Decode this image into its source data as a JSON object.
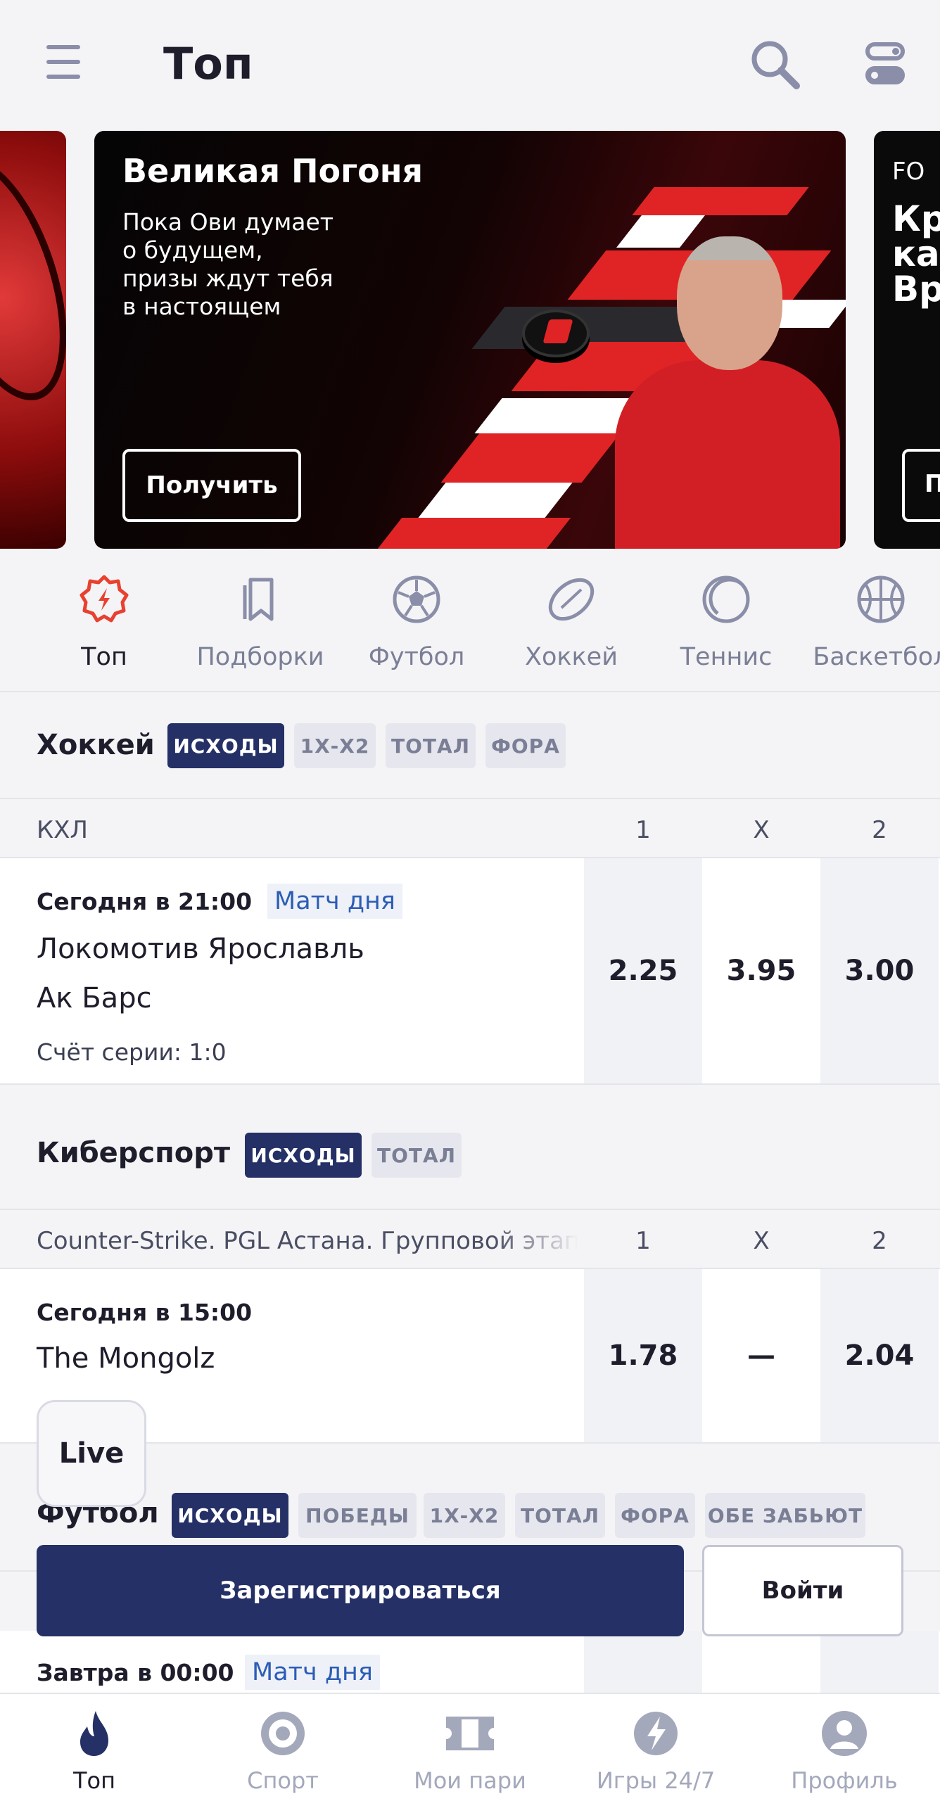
{
  "header": {
    "title": "Топ"
  },
  "banners": {
    "main": {
      "title": "Великая Погоня",
      "lines": [
        "Пока Ови думает",
        "о будущем,",
        "призы ждут тебя",
        "в настоящем"
      ],
      "button": "Получить"
    },
    "right": {
      "top": "FO",
      "lines": [
        "Кр",
        "ка",
        "Вр"
      ],
      "button": "П"
    }
  },
  "sport_tabs": [
    {
      "label": "Топ",
      "icon": "top-icon"
    },
    {
      "label": "Подборки",
      "icon": "bookmarks-icon"
    },
    {
      "label": "Футбол",
      "icon": "soccer-ball-icon"
    },
    {
      "label": "Хоккей",
      "icon": "hockey-puck-icon"
    },
    {
      "label": "Теннис",
      "icon": "tennis-ball-icon"
    },
    {
      "label": "Баскетбол",
      "icon": "basketball-icon"
    }
  ],
  "hockey": {
    "title": "Хоккей",
    "chips": [
      "ИСХОДЫ",
      "1Х-Х2",
      "ТОТАЛ",
      "ФОРА"
    ],
    "league": "КХЛ",
    "cols": [
      "1",
      "X",
      "2"
    ],
    "match": {
      "time": "Сегодня в 21:00",
      "badge": "Матч дня",
      "team1": "Локомотив Ярославль",
      "team2": "Ак Барс",
      "extra": "Счёт серии: 1:0",
      "odds": [
        "2.25",
        "3.95",
        "3.00"
      ]
    }
  },
  "esports": {
    "title": "Киберспорт",
    "chips": [
      "ИСХОДЫ",
      "ТОТАЛ"
    ],
    "league": "Counter-Strike. PGL Астана. Групповой этап",
    "cols": [
      "1",
      "X",
      "2"
    ],
    "match": {
      "time": "Сегодня в 15:00",
      "team1": "The Mongolz",
      "odds": [
        "1.78",
        "—",
        "2.04"
      ]
    }
  },
  "football": {
    "title": "Футбол",
    "chips": [
      "ИСХОДЫ",
      "ПОБЕДЫ",
      "1Х-Х2",
      "ТОТАЛ",
      "ФОРА",
      "ОБЕ ЗАБЬЮТ"
    ],
    "match": {
      "time": "Завтра в 00:00",
      "badge": "Матч дня"
    }
  },
  "live_button": "Live",
  "auth": {
    "register": "Зарегистрироваться",
    "login": "Войти"
  },
  "bottom_nav": [
    {
      "label": "Топ",
      "icon": "flame-icon"
    },
    {
      "label": "Спорт",
      "icon": "target-icon"
    },
    {
      "label": "Мои пари",
      "icon": "ticket-icon"
    },
    {
      "label": "Игры 24/7",
      "icon": "lightning-icon"
    },
    {
      "label": "Профиль",
      "icon": "profile-icon"
    }
  ],
  "colors": {
    "accent": "#243066",
    "brand_red": "#e02426",
    "active_icon": "#e8412f",
    "link": "#2c5db5"
  }
}
